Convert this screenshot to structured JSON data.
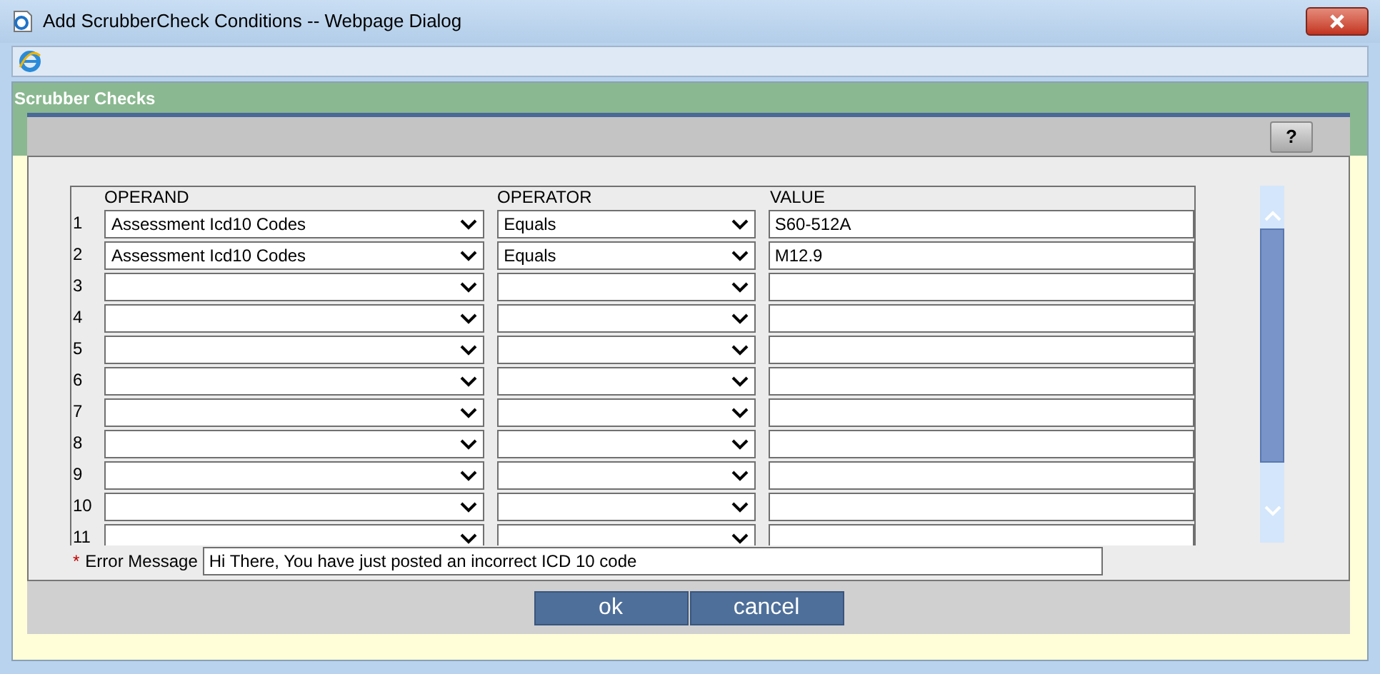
{
  "window": {
    "title": "Add ScrubberCheck Conditions -- Webpage Dialog"
  },
  "section": {
    "title": "Scrubber Checks",
    "help_button": "?"
  },
  "table": {
    "columns": [
      "OPERAND",
      "OPERATOR",
      "VALUE"
    ],
    "rows": [
      {
        "number": "1",
        "operand": "Assessment Icd10 Codes",
        "operator": "Equals",
        "value": "S60-512A"
      },
      {
        "number": "2",
        "operand": "Assessment Icd10 Codes",
        "operator": "Equals",
        "value": "M12.9"
      },
      {
        "number": "3"
      },
      {
        "number": "4"
      },
      {
        "number": "5"
      },
      {
        "number": "6"
      },
      {
        "number": "7"
      },
      {
        "number": "8"
      },
      {
        "number": "9"
      },
      {
        "number": "10"
      },
      {
        "number": "11"
      }
    ]
  },
  "error_message": {
    "required_mark": "*",
    "label": "Error Message",
    "value": "Hi There, You have just posted an incorrect ICD 10 code"
  },
  "buttons": [
    "ok",
    "cancel"
  ]
}
